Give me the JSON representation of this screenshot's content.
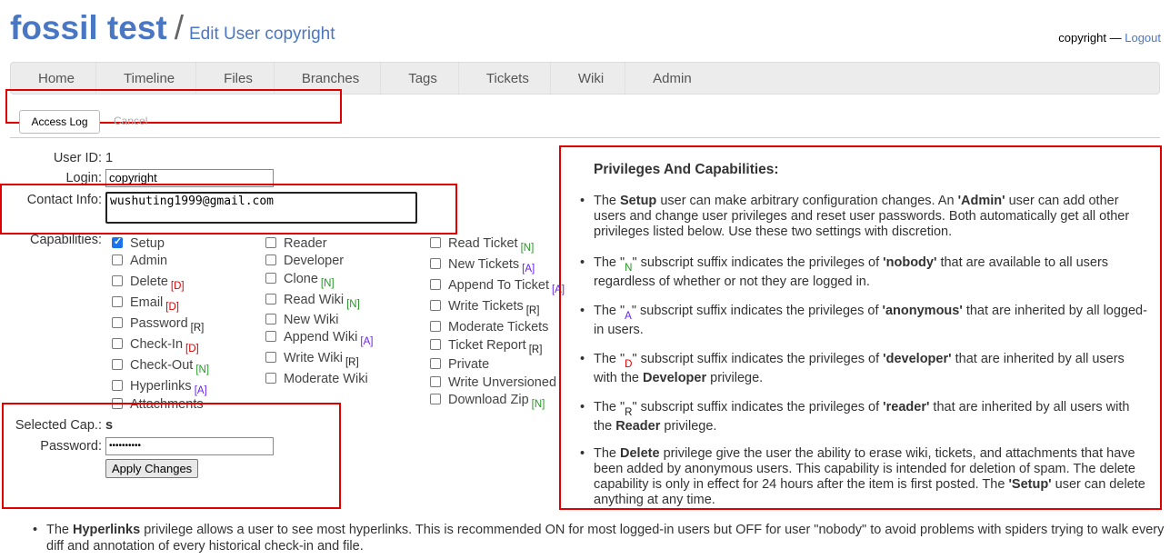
{
  "header": {
    "project_name": "fossil test",
    "separator": "/",
    "page_title": "Edit User copyright",
    "login_user": "copyright —",
    "logout_label": "Logout"
  },
  "mainmenu": [
    "Home",
    "Timeline",
    "Files",
    "Branches",
    "Tags",
    "Tickets",
    "Wiki",
    "Admin"
  ],
  "submenu": {
    "access_log": "Access Log",
    "cancel": "Cancel"
  },
  "form": {
    "user_id_label": "User ID:",
    "user_id": "1",
    "login_label": "Login:",
    "login_value": "copyright",
    "contact_label": "Contact Info:",
    "contact_value": "wushuting1999@gmail.com",
    "capabilities_label": "Capabilities:",
    "selected_cap_label": "Selected Cap.:",
    "selected_cap": "s",
    "password_label": "Password:",
    "password_value": "••••••••••",
    "apply_label": "Apply Changes"
  },
  "capabilities": {
    "col1": [
      {
        "label": "Setup",
        "suffix": "",
        "checked": true
      },
      {
        "label": "Admin",
        "suffix": "",
        "checked": false
      },
      {
        "label": "Delete",
        "suffix": "[D]",
        "checked": false
      },
      {
        "label": "Email",
        "suffix": "[D]",
        "checked": false
      },
      {
        "label": "Password",
        "suffix": "[R]",
        "checked": false
      },
      {
        "label": "Check-In",
        "suffix": "[D]",
        "checked": false
      },
      {
        "label": "Check-Out",
        "suffix": "[N]",
        "checked": false
      },
      {
        "label": "Hyperlinks",
        "suffix": "[A]",
        "checked": false
      },
      {
        "label": "Attachments",
        "suffix": "",
        "checked": false
      }
    ],
    "col2": [
      {
        "label": "Reader",
        "suffix": "",
        "checked": false
      },
      {
        "label": "Developer",
        "suffix": "",
        "checked": false
      },
      {
        "label": "Clone",
        "suffix": "[N]",
        "checked": false
      },
      {
        "label": "Read Wiki",
        "suffix": "[N]",
        "checked": false
      },
      {
        "label": "New Wiki",
        "suffix": "",
        "checked": false
      },
      {
        "label": "Append Wiki",
        "suffix": "[A]",
        "checked": false
      },
      {
        "label": "Write Wiki",
        "suffix": "[R]",
        "checked": false
      },
      {
        "label": "Moderate Wiki",
        "suffix": "",
        "checked": false
      }
    ],
    "col3": [
      {
        "label": "Read Ticket",
        "suffix": "[N]",
        "checked": false
      },
      {
        "label": "New Tickets",
        "suffix": "[A]",
        "checked": false
      },
      {
        "label": "Append To Ticket",
        "suffix": "[A]",
        "checked": false
      },
      {
        "label": "Write Tickets",
        "suffix": "[R]",
        "checked": false
      },
      {
        "label": "Moderate Tickets",
        "suffix": "",
        "checked": false
      },
      {
        "label": "Ticket Report",
        "suffix": "[R]",
        "checked": false
      },
      {
        "label": "Private",
        "suffix": "",
        "checked": false
      },
      {
        "label": "Write Unversioned",
        "suffix": "",
        "checked": false
      },
      {
        "label": "Download Zip",
        "suffix": "[N]",
        "checked": false
      }
    ]
  },
  "help": {
    "title": "Privileges And Capabilities:",
    "items": [
      {
        "a": "The ",
        "b": "Setup",
        "c": " user can make arbitrary configuration changes. An ",
        "d": "'Admin'",
        "e": " user can add other users and change user privileges and reset user passwords. Both automatically get all other privileges listed below. Use these two settings with discretion."
      },
      {
        "a": "The \"",
        "sub": "N",
        "c": "\" subscript suffix indicates the privileges of ",
        "d": "'nobody'",
        "e": " that are available to all users regardless of whether or not they are logged in."
      },
      {
        "a": "The \"",
        "sub": "A",
        "c": "\" subscript suffix indicates the privileges of ",
        "d": "'anonymous'",
        "e": " that are inherited by all logged-in users."
      },
      {
        "a": "The \"",
        "sub": "D",
        "c": "\" subscript suffix indicates the privileges of ",
        "d": "'developer'",
        "e": " that are inherited by all users with the ",
        "f": "Developer",
        "g": " privilege."
      },
      {
        "a": "The \"",
        "sub": "R",
        "c": "\" subscript suffix indicates the privileges of ",
        "d": "'reader'",
        "e": " that are inherited by all users with the ",
        "f": "Reader",
        "g": " privilege."
      },
      {
        "a": "The ",
        "b": "Delete",
        "c": " privilege give the user the ability to erase wiki, tickets, and attachments that have been added by anonymous users. This capability is intended for deletion of spam. The delete capability is only in effect for 24 hours after the item is first posted. The ",
        "d": "'Setup'",
        "e": " user can delete anything at any time."
      }
    ]
  },
  "bottom": {
    "a": "The ",
    "b": "Hyperlinks",
    "c": " privilege allows a user to see most hyperlinks. This is recommended ON for most logged-in users but OFF for user \"nobody\" to avoid problems with spiders trying to walk every diff and annotation of every historical check-in and file."
  }
}
